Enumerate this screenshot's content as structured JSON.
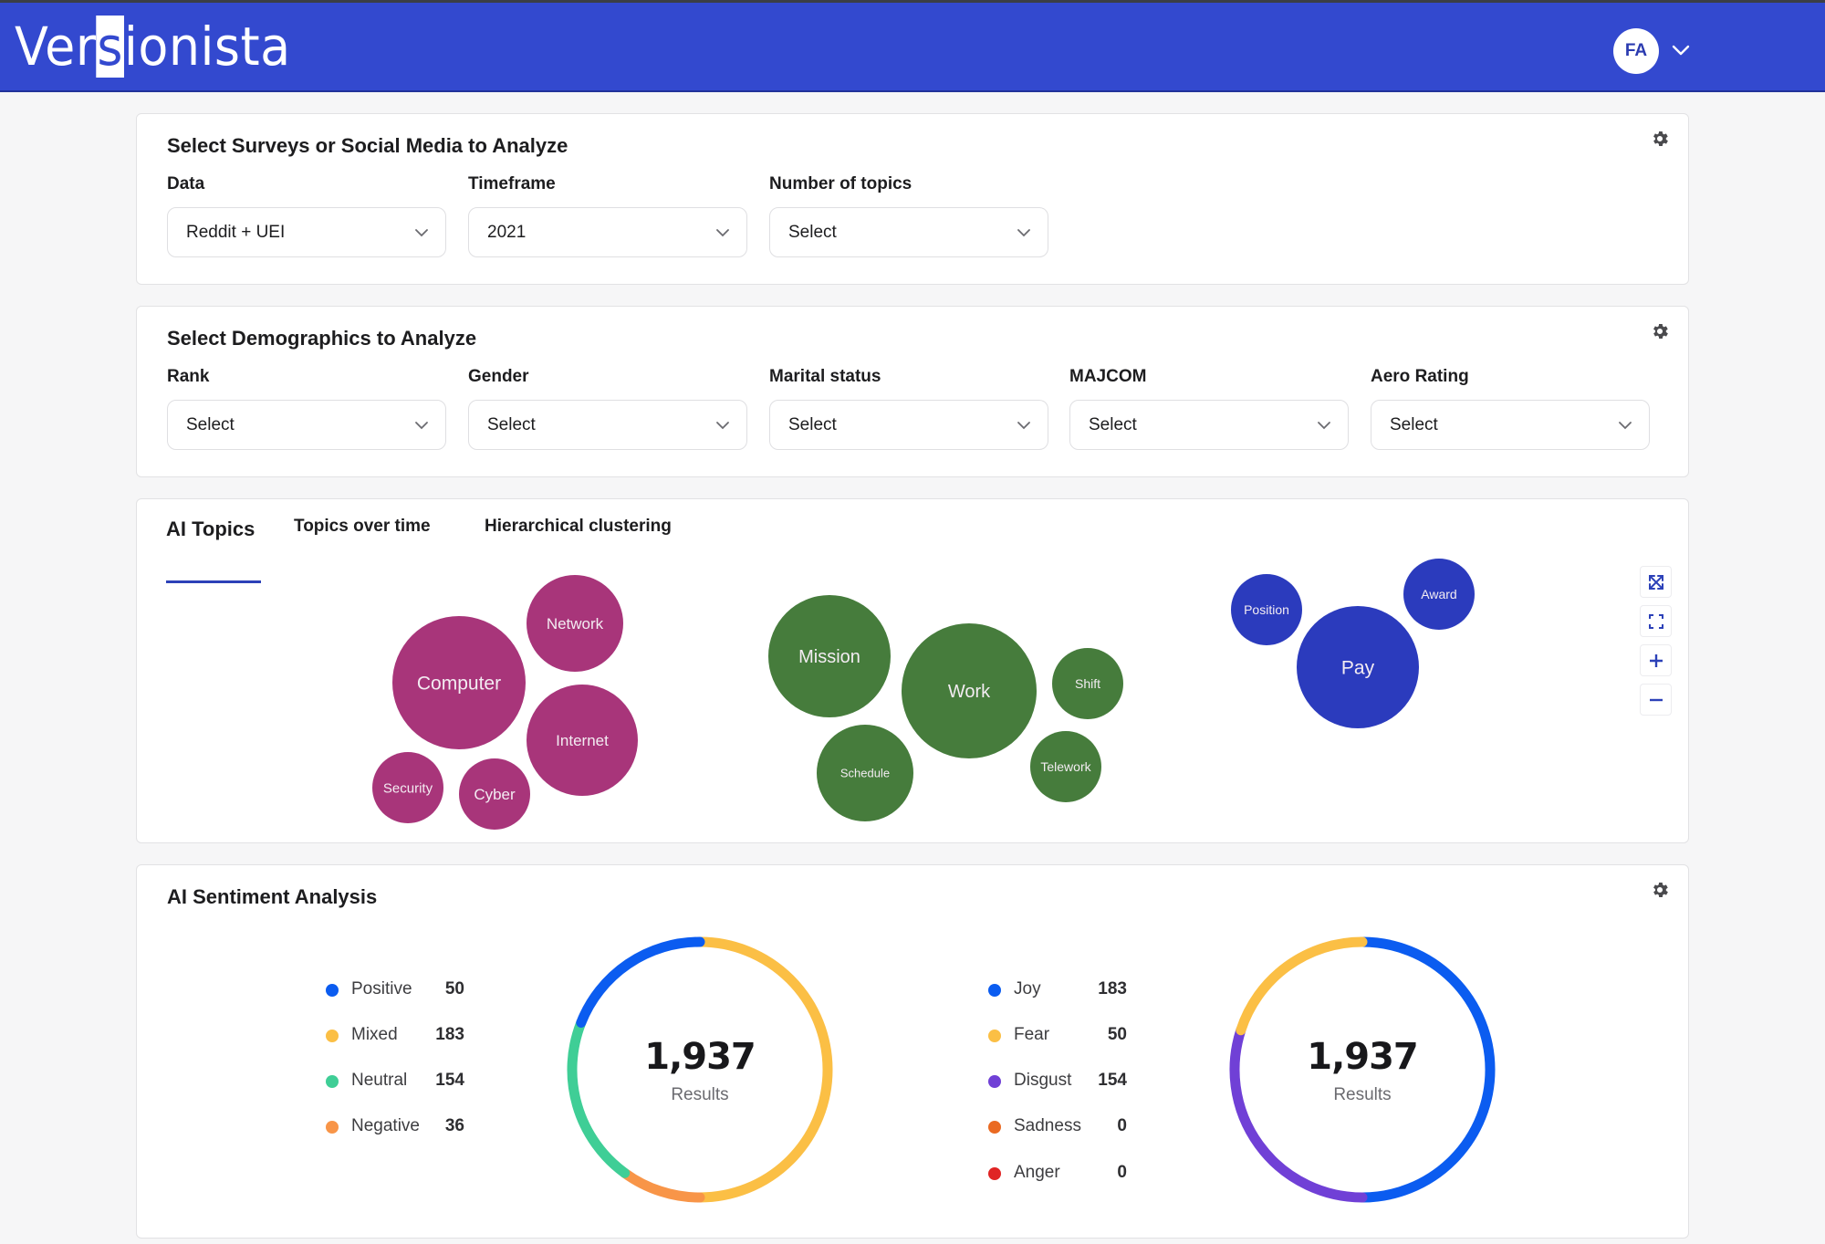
{
  "app": {
    "logo_text_before": "Ver",
    "logo_text_highlight": "s",
    "logo_text_after": "ionista",
    "user_initials": "FA",
    "brand_color": "#3349cf"
  },
  "surveys_panel": {
    "title": "Select Surveys or Social Media to Analyze",
    "fields": [
      {
        "label": "Data",
        "value": "Reddit + UEI"
      },
      {
        "label": "Timeframe",
        "value": "2021"
      },
      {
        "label": "Number of topics",
        "value": "Select"
      }
    ]
  },
  "demographics_panel": {
    "title": "Select Demographics to Analyze",
    "fields": [
      {
        "label": "Rank",
        "value": "Select"
      },
      {
        "label": "Gender",
        "value": "Select"
      },
      {
        "label": "Marital status",
        "value": "Select"
      },
      {
        "label": "MAJCOM",
        "value": "Select"
      },
      {
        "label": "Aero Rating",
        "value": "Select"
      }
    ]
  },
  "topics_panel": {
    "tabs": [
      {
        "label": "AI Topics",
        "active": true
      },
      {
        "label": "Topics over time",
        "active": false
      },
      {
        "label": "Hierarchical clustering",
        "active": false
      }
    ],
    "controls": [
      "fit-view",
      "fullscreen",
      "zoom-in",
      "zoom-out"
    ],
    "clusters": [
      {
        "color": "#a8357a",
        "topics": [
          "Computer",
          "Network",
          "Internet",
          "Security",
          "Cyber"
        ]
      },
      {
        "color": "#467c3c",
        "topics": [
          "Mission",
          "Work",
          "Shift",
          "Schedule",
          "Telework"
        ]
      },
      {
        "color": "#2b3bbd",
        "topics": [
          "Position",
          "Pay",
          "Award"
        ]
      }
    ]
  },
  "sentiment_panel": {
    "title": "AI Sentiment Analysis",
    "sentiment": {
      "total": "1,937",
      "total_label": "Results",
      "items": [
        {
          "label": "Positive",
          "value": 50,
          "color": "#0b5cf0"
        },
        {
          "label": "Mixed",
          "value": 183,
          "color": "#fbbf45"
        },
        {
          "label": "Neutral",
          "value": 154,
          "color": "#3fce96"
        },
        {
          "label": "Negative",
          "value": 36,
          "color": "#f89548"
        }
      ]
    },
    "emotion": {
      "total": "1,937",
      "total_label": "Results",
      "items": [
        {
          "label": "Joy",
          "value": 183,
          "color": "#0b5cf0"
        },
        {
          "label": "Fear",
          "value": 50,
          "color": "#fbbf45"
        },
        {
          "label": "Disgust",
          "value": 154,
          "color": "#7040d6"
        },
        {
          "label": "Sadness",
          "value": 0,
          "color": "#ea6a22"
        },
        {
          "label": "Anger",
          "value": 0,
          "color": "#e02424"
        }
      ]
    }
  }
}
